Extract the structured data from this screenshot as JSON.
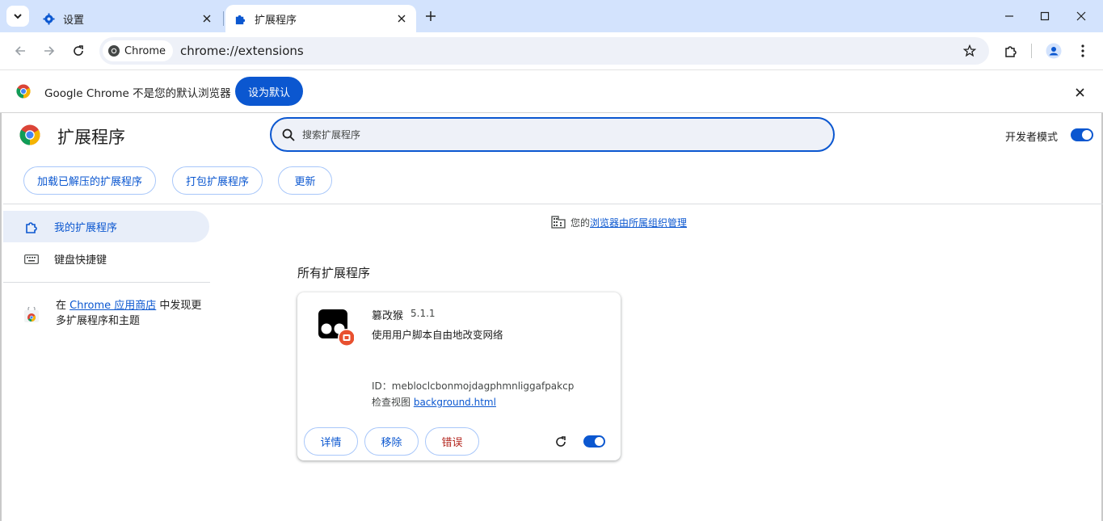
{
  "tabs": [
    {
      "label": "设置",
      "icon": "gear-icon",
      "active": false
    },
    {
      "label": "扩展程序",
      "icon": "puzzle-icon",
      "active": true
    }
  ],
  "toolbar": {
    "chip_label": "Chrome",
    "url": "chrome://extensions"
  },
  "infobar": {
    "message": "Google Chrome 不是您的默认浏览器",
    "button_label": "设为默认"
  },
  "header": {
    "title": "扩展程序",
    "search_placeholder": "搜索扩展程序",
    "dev_mode_label": "开发者模式",
    "dev_mode_on": true
  },
  "actions": {
    "load_unpacked": "加载已解压的扩展程序",
    "pack": "打包扩展程序",
    "update": "更新"
  },
  "sidebar": {
    "items": [
      {
        "label": "我的扩展程序",
        "icon": "puzzle-outline-icon",
        "active": true
      },
      {
        "label": "键盘快捷键",
        "icon": "keyboard-icon",
        "active": false
      }
    ],
    "store_prefix": "在 ",
    "store_link": "Chrome 应用商店",
    "store_suffix": " 中发现更多扩展程序和主题"
  },
  "managed": {
    "prefix": "您的",
    "link": "浏览器由所属组织管理"
  },
  "section_title": "所有扩展程序",
  "extension": {
    "name": "篡改猴",
    "version": "5.1.1",
    "description": "使用用户脚本自由地改变网络",
    "id_label": "ID：",
    "id": "mebloclcbonmojdagphmnliggafpakcp",
    "views_label": "检查视图 ",
    "views_link": "background.html",
    "details_label": "详情",
    "remove_label": "移除",
    "errors_label": "错误",
    "enabled": true
  },
  "colors": {
    "accent": "#0b57d0",
    "tabstrip": "#d3e3fd",
    "error": "#b3261e"
  }
}
